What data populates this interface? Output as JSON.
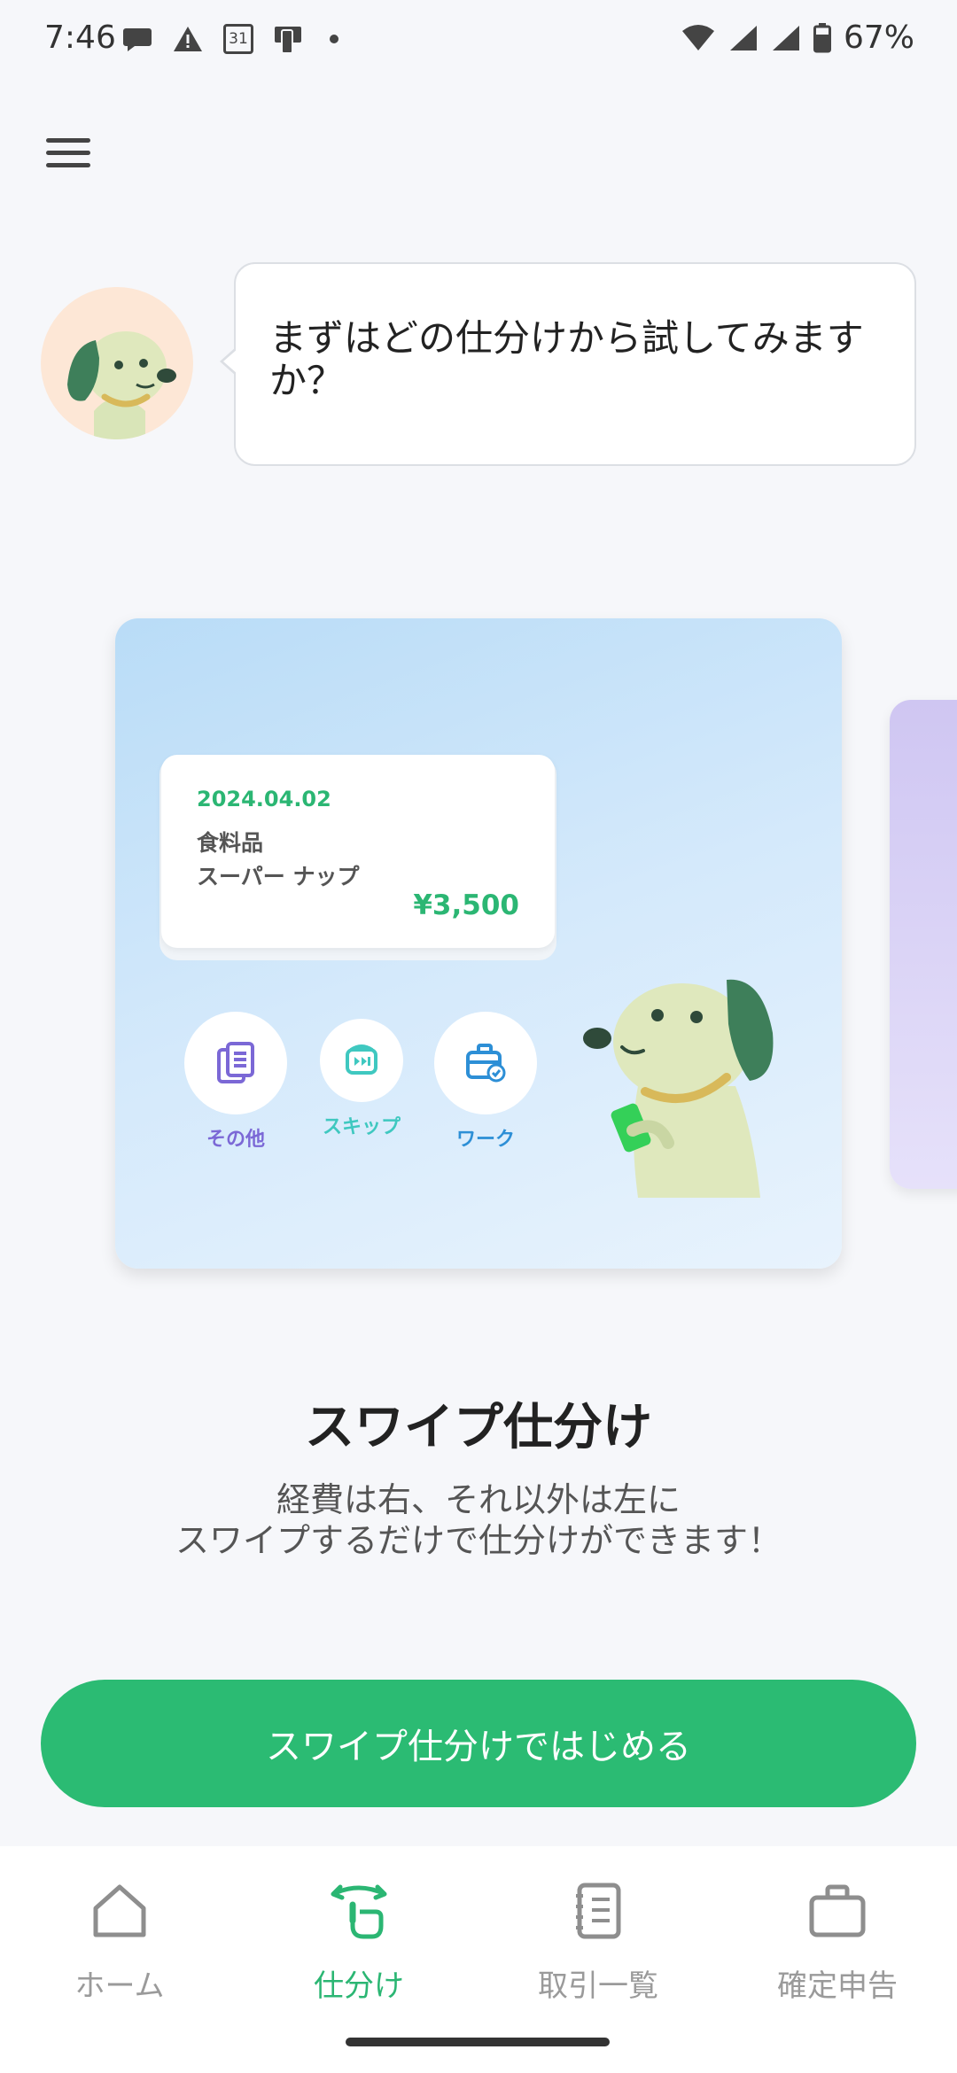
{
  "status_bar": {
    "time": "7:46",
    "calendar_day": "31",
    "battery_percent": "67%"
  },
  "assistant": {
    "message": "まずはどの仕分けから試してみますか？"
  },
  "card": {
    "transaction": {
      "date": "2024.04.02",
      "category": "食料品",
      "store": "スーパー ナップ",
      "amount": "¥3,500"
    },
    "actions": [
      {
        "label": "その他",
        "color": "#7b68d6",
        "icon": "documents-icon"
      },
      {
        "label": "スキップ",
        "color": "#3fc8c0",
        "icon": "skip-icon"
      },
      {
        "label": "ワーク",
        "color": "#2d8fd6",
        "icon": "work-bag-icon"
      }
    ]
  },
  "feature": {
    "title": "スワイプ仕分け",
    "description_line1": "経費は右、それ以外は左に",
    "description_line2": "スワイプするだけで仕分けができます！"
  },
  "cta": {
    "label": "スワイプ仕分けではじめる"
  },
  "bottom_nav": {
    "items": [
      {
        "label": "ホーム",
        "icon": "home-icon",
        "active": false
      },
      {
        "label": "仕分け",
        "icon": "swipe-hand-icon",
        "active": true
      },
      {
        "label": "取引一覧",
        "icon": "notebook-icon",
        "active": false
      },
      {
        "label": "確定申告",
        "icon": "briefcase-icon",
        "active": false
      }
    ]
  },
  "colors": {
    "accent": "#2bbb73",
    "background": "#f6f7fa"
  }
}
